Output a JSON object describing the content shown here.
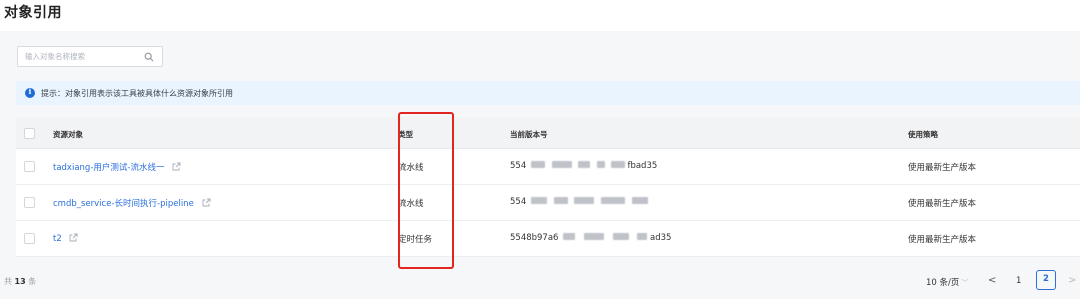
{
  "title": "对象引用",
  "search": {
    "placeholder": "输入对象名称搜索"
  },
  "tip": "提示：对象引用表示该工具被具体什么资源对象所引用",
  "columns": {
    "resource": "资源对象",
    "type": "类型",
    "version": "当前版本号",
    "policy": "使用策略"
  },
  "rows": [
    {
      "name": "tadxiang-用户测试-流水线一",
      "type": "流水线",
      "version_prefix": "554",
      "version_suffix": "fbad35",
      "policy": "使用最新生产版本"
    },
    {
      "name": "cmdb_service-长时间执行-pipeline",
      "type": "流水线",
      "version_prefix": "554",
      "version_suffix": "",
      "policy": "使用最新生产版本"
    },
    {
      "name": "t2",
      "type": "定时任务",
      "version_prefix": "5548b97a6",
      "version_suffix": "ad35",
      "policy": "使用最新生产版本"
    }
  ],
  "footer": {
    "total_prefix": "共",
    "total_count": "13",
    "total_suffix": "条",
    "page_size": "10 条/页",
    "pages": [
      "1",
      "2"
    ],
    "current_page": "2"
  }
}
